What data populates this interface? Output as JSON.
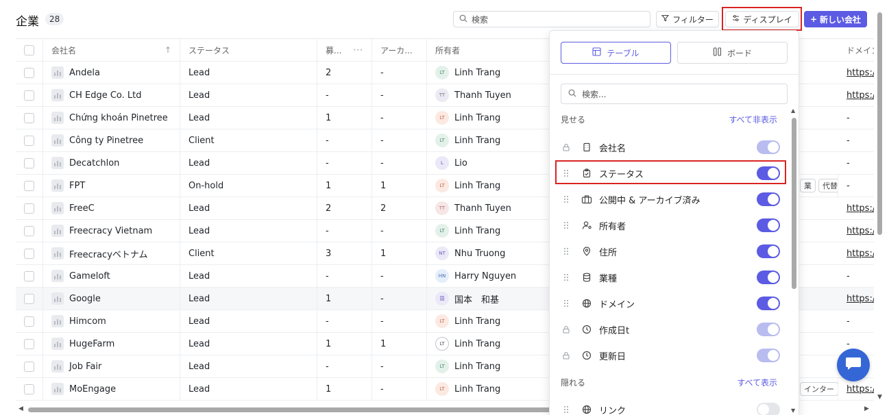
{
  "header": {
    "title": "企業",
    "count": "28",
    "search_placeholder": "検索",
    "filter_label": "フィルター",
    "display_label": "ディスプレイ",
    "new_label": "新しい会社"
  },
  "table": {
    "columns": {
      "name": "会社名",
      "status": "ステータス",
      "recruit": "募...",
      "archive": "アーカ...",
      "owner": "所有者",
      "domain": "ドメイン"
    },
    "rows": [
      {
        "name": "Andela",
        "status": "Lead",
        "recruit": "2",
        "archive": "-",
        "owner": "Linh Trang",
        "initials": "LT",
        "domain": "https:/"
      },
      {
        "name": "CH Edge Co. Ltd",
        "status": "Lead",
        "recruit": "-",
        "archive": "-",
        "owner": "Thanh Tuyen",
        "initials": "TT",
        "domain": "https:/"
      },
      {
        "name": "Chứng khoán Pinetree",
        "status": "Lead",
        "recruit": "1",
        "archive": "-",
        "owner": "Linh Trang",
        "initials": "LT",
        "domain": "-"
      },
      {
        "name": "Công ty Pinetree",
        "status": "Client",
        "recruit": "-",
        "archive": "-",
        "owner": "Linh Trang",
        "initials": "LT",
        "domain": "-"
      },
      {
        "name": "Decatchlon",
        "status": "Lead",
        "recruit": "-",
        "archive": "-",
        "owner": "Lio",
        "initials": "L",
        "domain": "-"
      },
      {
        "name": "FPT",
        "status": "On-hold",
        "recruit": "1",
        "archive": "1",
        "owner": "Linh Trang",
        "initials": "LT",
        "domain": "-",
        "tags": [
          "業",
          "代替"
        ]
      },
      {
        "name": "FreeC",
        "status": "Lead",
        "recruit": "2",
        "archive": "2",
        "owner": "Thanh Tuyen",
        "initials": "TT",
        "domain": "https:/"
      },
      {
        "name": "Freecracy Vietnam",
        "status": "Lead",
        "recruit": "-",
        "archive": "-",
        "owner": "Linh Trang",
        "initials": "LT",
        "domain": "https:/"
      },
      {
        "name": "Freecracyベトナム",
        "status": "Client",
        "recruit": "3",
        "archive": "1",
        "owner": "Nhu Truong",
        "initials": "NT",
        "domain": "https:/"
      },
      {
        "name": "Gameloft",
        "status": "Lead",
        "recruit": "-",
        "archive": "-",
        "owner": "Harry Nguyen",
        "initials": "HN",
        "domain": "-"
      },
      {
        "name": "Google",
        "status": "Lead",
        "recruit": "1",
        "archive": "-",
        "owner": "国本　和基",
        "initials": "国",
        "domain": "https:/"
      },
      {
        "name": "Himcom",
        "status": "Lead",
        "recruit": "-",
        "archive": "-",
        "owner": "Linh Trang",
        "initials": "LT",
        "domain": "-"
      },
      {
        "name": "HugeFarm",
        "status": "Lead",
        "recruit": "1",
        "archive": "1",
        "owner": "Linh Trang",
        "initials": "LT",
        "domain": "-"
      },
      {
        "name": "Job Fair",
        "status": "Lead",
        "recruit": "-",
        "archive": "-",
        "owner": "Linh Trang",
        "initials": "LT",
        "domain": "-"
      },
      {
        "name": "MoEngage",
        "status": "Lead",
        "recruit": "1",
        "archive": "-",
        "owner": "Linh Trang",
        "initials": "LT",
        "domain": "https:/",
        "tags": [
          "インター"
        ]
      }
    ]
  },
  "display_panel": {
    "view_table": "テーブル",
    "view_board": "ボード",
    "search_placeholder": "検索...",
    "visible_label": "見せる",
    "hide_all": "すべて非表示",
    "hidden_label": "隠れる",
    "show_all": "すべて表示",
    "visible_fields": [
      {
        "label": "会社名",
        "icon": "building-icon",
        "locked": true,
        "state": "locked"
      },
      {
        "label": "ステータス",
        "icon": "clipboard-check-icon",
        "locked": false,
        "state": "on"
      },
      {
        "label": "公開中 & アーカイブ済み",
        "icon": "briefcase-icon",
        "locked": false,
        "state": "on"
      },
      {
        "label": "所有者",
        "icon": "user-settings-icon",
        "locked": false,
        "state": "on"
      },
      {
        "label": "住所",
        "icon": "map-pin-icon",
        "locked": false,
        "state": "on"
      },
      {
        "label": "業種",
        "icon": "database-icon",
        "locked": false,
        "state": "on"
      },
      {
        "label": "ドメイン",
        "icon": "globe-icon",
        "locked": false,
        "state": "on"
      },
      {
        "label": "作成日t",
        "icon": "clock-icon",
        "locked": true,
        "state": "locked"
      },
      {
        "label": "更新日",
        "icon": "clock-icon",
        "locked": true,
        "state": "locked"
      }
    ],
    "hidden_fields": [
      {
        "label": "リンク",
        "icon": "globe-icon",
        "locked": false,
        "state": "off"
      }
    ]
  },
  "colors": {
    "accent": "#5b5be3",
    "highlight_border": "#d92323",
    "chat": "#3566d6"
  }
}
